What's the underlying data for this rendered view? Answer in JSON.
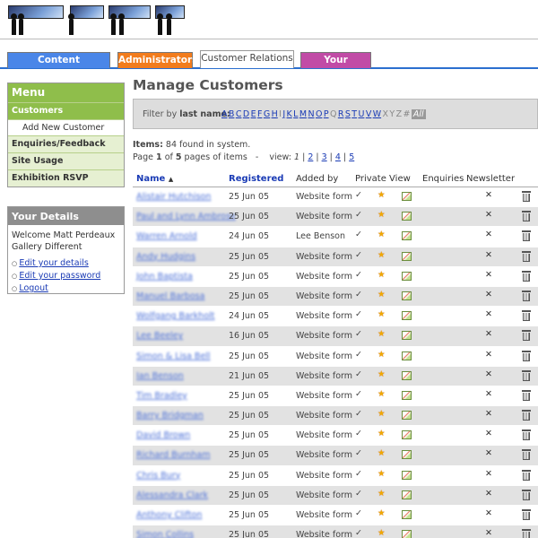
{
  "tabs": [
    {
      "label": "Content Management"
    },
    {
      "label": "Administrators"
    },
    {
      "label": "Customer Relations"
    },
    {
      "label": "Your Account"
    }
  ],
  "menu": {
    "title": "Menu",
    "items": [
      {
        "label": "Customers"
      },
      {
        "label": "Add New Customer"
      },
      {
        "label": "Enquiries/Feedback"
      },
      {
        "label": "Site Usage"
      },
      {
        "label": "Exhibition RSVP"
      }
    ]
  },
  "details": {
    "title": "Your Details",
    "welcome_line1": "Welcome Matt Perdeaux",
    "welcome_line2": "Gallery Different",
    "links": [
      {
        "label": "Edit your details"
      },
      {
        "label": "Edit your password"
      },
      {
        "label": "Logout"
      }
    ]
  },
  "page": {
    "title": "Manage Customers",
    "filter_label_prefix": "Filter by",
    "filter_label_bold": "last name:",
    "letters": [
      "A",
      "B",
      "C",
      "D",
      "E",
      "F",
      "G",
      "H",
      "I",
      "J",
      "K",
      "L",
      "M",
      "N",
      "O",
      "P",
      "Q",
      "R",
      "S",
      "T",
      "U",
      "V",
      "W",
      "X",
      "Y",
      "Z",
      "#"
    ],
    "letters_linked": [
      "A",
      "B",
      "C",
      "D",
      "E",
      "F",
      "G",
      "H",
      "J",
      "K",
      "L",
      "M",
      "N",
      "O",
      "P",
      "R",
      "S",
      "T",
      "U",
      "V",
      "W"
    ],
    "all_label": "All",
    "items_label": "Items:",
    "items_text": "84 found in system.",
    "page_word": "Page",
    "current_page": "1",
    "of_word": "of",
    "total_pages": "5",
    "pages_suffix": "pages of items",
    "view_label": "view:",
    "view_current": "1",
    "view_pages": [
      "2",
      "3",
      "4",
      "5"
    ]
  },
  "table": {
    "columns": {
      "name": "Name",
      "sort_arrow": "▲",
      "registered": "Registered",
      "added_by": "Added by",
      "private_view": "Private View",
      "enquiries": "Enquiries",
      "newsletter": "Newsletter"
    },
    "rows": [
      {
        "name": "Alistair Hutchison",
        "registered": "25 Jun 05",
        "added_by": "Website form"
      },
      {
        "name": "Paul and Lynn Ambrose",
        "registered": "25 Jun 05",
        "added_by": "Website form"
      },
      {
        "name": "Warren Arnold",
        "registered": "24 Jun 05",
        "added_by": "Lee Benson"
      },
      {
        "name": "Andy Hudgins",
        "registered": "25 Jun 05",
        "added_by": "Website form"
      },
      {
        "name": "John Baptista",
        "registered": "25 Jun 05",
        "added_by": "Website form"
      },
      {
        "name": "Manuel Barbosa",
        "registered": "25 Jun 05",
        "added_by": "Website form"
      },
      {
        "name": "Wolfgang Barkholt",
        "registered": "24 Jun 05",
        "added_by": "Website form"
      },
      {
        "name": "Lee Beeley",
        "registered": "16 Jun 05",
        "added_by": "Website form"
      },
      {
        "name": "Simon & Lisa Bell",
        "registered": "25 Jun 05",
        "added_by": "Website form"
      },
      {
        "name": "Ian Benson",
        "registered": "21 Jun 05",
        "added_by": "Website form"
      },
      {
        "name": "Tim Bradley",
        "registered": "25 Jun 05",
        "added_by": "Website form"
      },
      {
        "name": "Barry Bridgman",
        "registered": "25 Jun 05",
        "added_by": "Website form"
      },
      {
        "name": "David Brown",
        "registered": "25 Jun 05",
        "added_by": "Website form"
      },
      {
        "name": "Richard Burnham",
        "registered": "25 Jun 05",
        "added_by": "Website form"
      },
      {
        "name": "Chris Bury",
        "registered": "25 Jun 05",
        "added_by": "Website form"
      },
      {
        "name": "Alessandra Clark",
        "registered": "25 Jun 05",
        "added_by": "Website form"
      },
      {
        "name": "Anthony Clifton",
        "registered": "25 Jun 05",
        "added_by": "Website form"
      },
      {
        "name": "Simon Collins",
        "registered": "25 Jun 05",
        "added_by": "Website form"
      }
    ]
  },
  "icons": {
    "check": "check-icon",
    "star": "star-icon",
    "chart": "chart-icon",
    "cross": "cross-icon",
    "bin": "trash-icon"
  },
  "colors": {
    "tab_content": "#4a86e8",
    "tab_admin": "#f27c1d",
    "tab_account": "#c14ba6",
    "menu_green": "#8fbe4b",
    "link_blue": "#1a3bb5",
    "row_alt": "#e2e2e2"
  }
}
